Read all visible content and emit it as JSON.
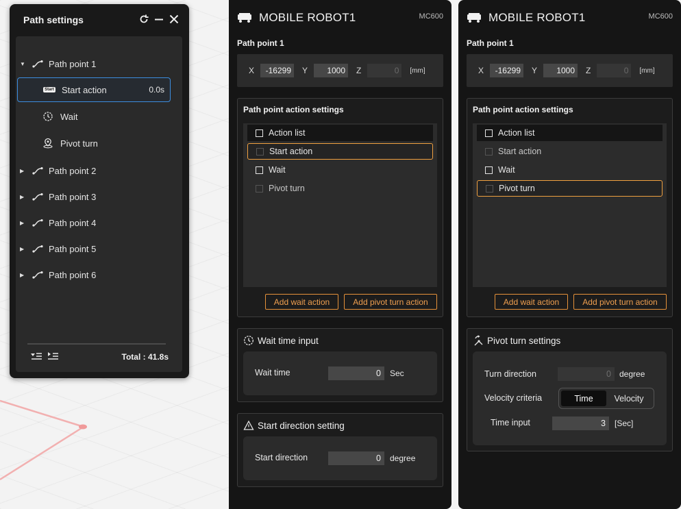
{
  "path_settings": {
    "title": "Path settings",
    "items": [
      {
        "label": "Path point 1",
        "expanded": true
      },
      {
        "label": "Start action",
        "duration": "0.0s",
        "badge": "Start",
        "selected": true
      },
      {
        "label": "Wait"
      },
      {
        "label": "Pivot turn"
      },
      {
        "label": "Path point 2"
      },
      {
        "label": "Path point 3"
      },
      {
        "label": "Path point 4"
      },
      {
        "label": "Path point 5"
      },
      {
        "label": "Path point 6"
      }
    ],
    "total": "Total : 41.8s"
  },
  "panel_left": {
    "robot_name": "MOBILE ROBOT1",
    "model": "MC600",
    "point_title": "Path point 1",
    "coords": {
      "x_label": "X",
      "x": "-16299",
      "y_label": "Y",
      "y": "1000",
      "z_label": "Z",
      "z": "0",
      "unit": "[mm]"
    },
    "action_settings": {
      "title": "Path point action settings",
      "header": "Action list",
      "items": [
        "Start action",
        "Wait",
        "Pivot turn"
      ],
      "add_wait": "Add wait action",
      "add_pivot": "Add pivot turn action"
    },
    "wait_time": {
      "title": "Wait time input",
      "label": "Wait time",
      "value": "0",
      "unit": "Sec"
    },
    "start_direction": {
      "title": "Start direction setting",
      "label": "Start direction",
      "value": "0",
      "unit": "degree"
    }
  },
  "panel_right": {
    "robot_name": "MOBILE ROBOT1",
    "model": "MC600",
    "point_title": "Path point 1",
    "coords": {
      "x_label": "X",
      "x": "-16299",
      "y_label": "Y",
      "y": "1000",
      "z_label": "Z",
      "z": "0",
      "unit": "[mm]"
    },
    "action_settings": {
      "title": "Path point action settings",
      "header": "Action list",
      "items": [
        "Start action",
        "Wait",
        "Pivot turn"
      ],
      "add_wait": "Add wait action",
      "add_pivot": "Add pivot turn action"
    },
    "pivot_turn": {
      "title": "Pivot turn settings",
      "turn_direction_label": "Turn direction",
      "turn_direction_value": "0",
      "turn_direction_unit": "degree",
      "velocity_label": "Velocity criteria",
      "option_time": "Time",
      "option_velocity": "Velocity",
      "selected_option": "Time",
      "time_input_label": "Time input",
      "time_input_value": "3",
      "time_input_unit": "[Sec]"
    }
  },
  "colors": {
    "accent_orange": "#e6923a",
    "selection_blue": "#3d8ee0",
    "panel_bg": "#151515",
    "path_line": "#f2a8a8"
  },
  "icons": {
    "refresh": "refresh-icon",
    "minimize": "minimize-icon",
    "close": "close-icon",
    "path": "path-point-icon",
    "timer": "timer-icon",
    "pivot": "pivot-turn-icon",
    "robot": "robot-icon",
    "triangle": "direction-triangle-icon"
  }
}
